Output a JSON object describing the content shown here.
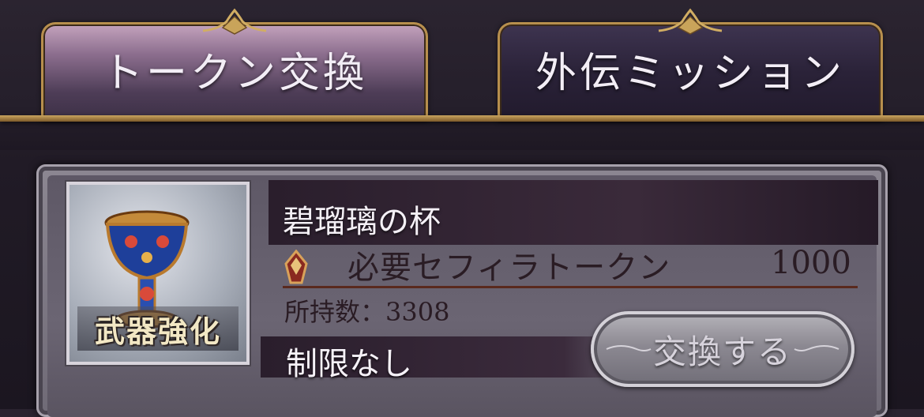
{
  "tabs": [
    {
      "label": "トークン交換",
      "active": true
    },
    {
      "label": "外伝ミッション",
      "active": false
    }
  ],
  "item": {
    "name": "碧瑠璃の杯",
    "badge": "武器強化",
    "icon": "chalice-icon",
    "requirement_label": "必要セフィラトークン",
    "requirement_value": "1000",
    "owned": "所持数：3308",
    "limit": "制限なし",
    "exchange_label": "交換する"
  },
  "colors": {
    "tab_border": "#b78f4d",
    "active_tab": "#8d6f8f",
    "inactive_tab": "#2a2238",
    "panel": "#6f6a76"
  }
}
